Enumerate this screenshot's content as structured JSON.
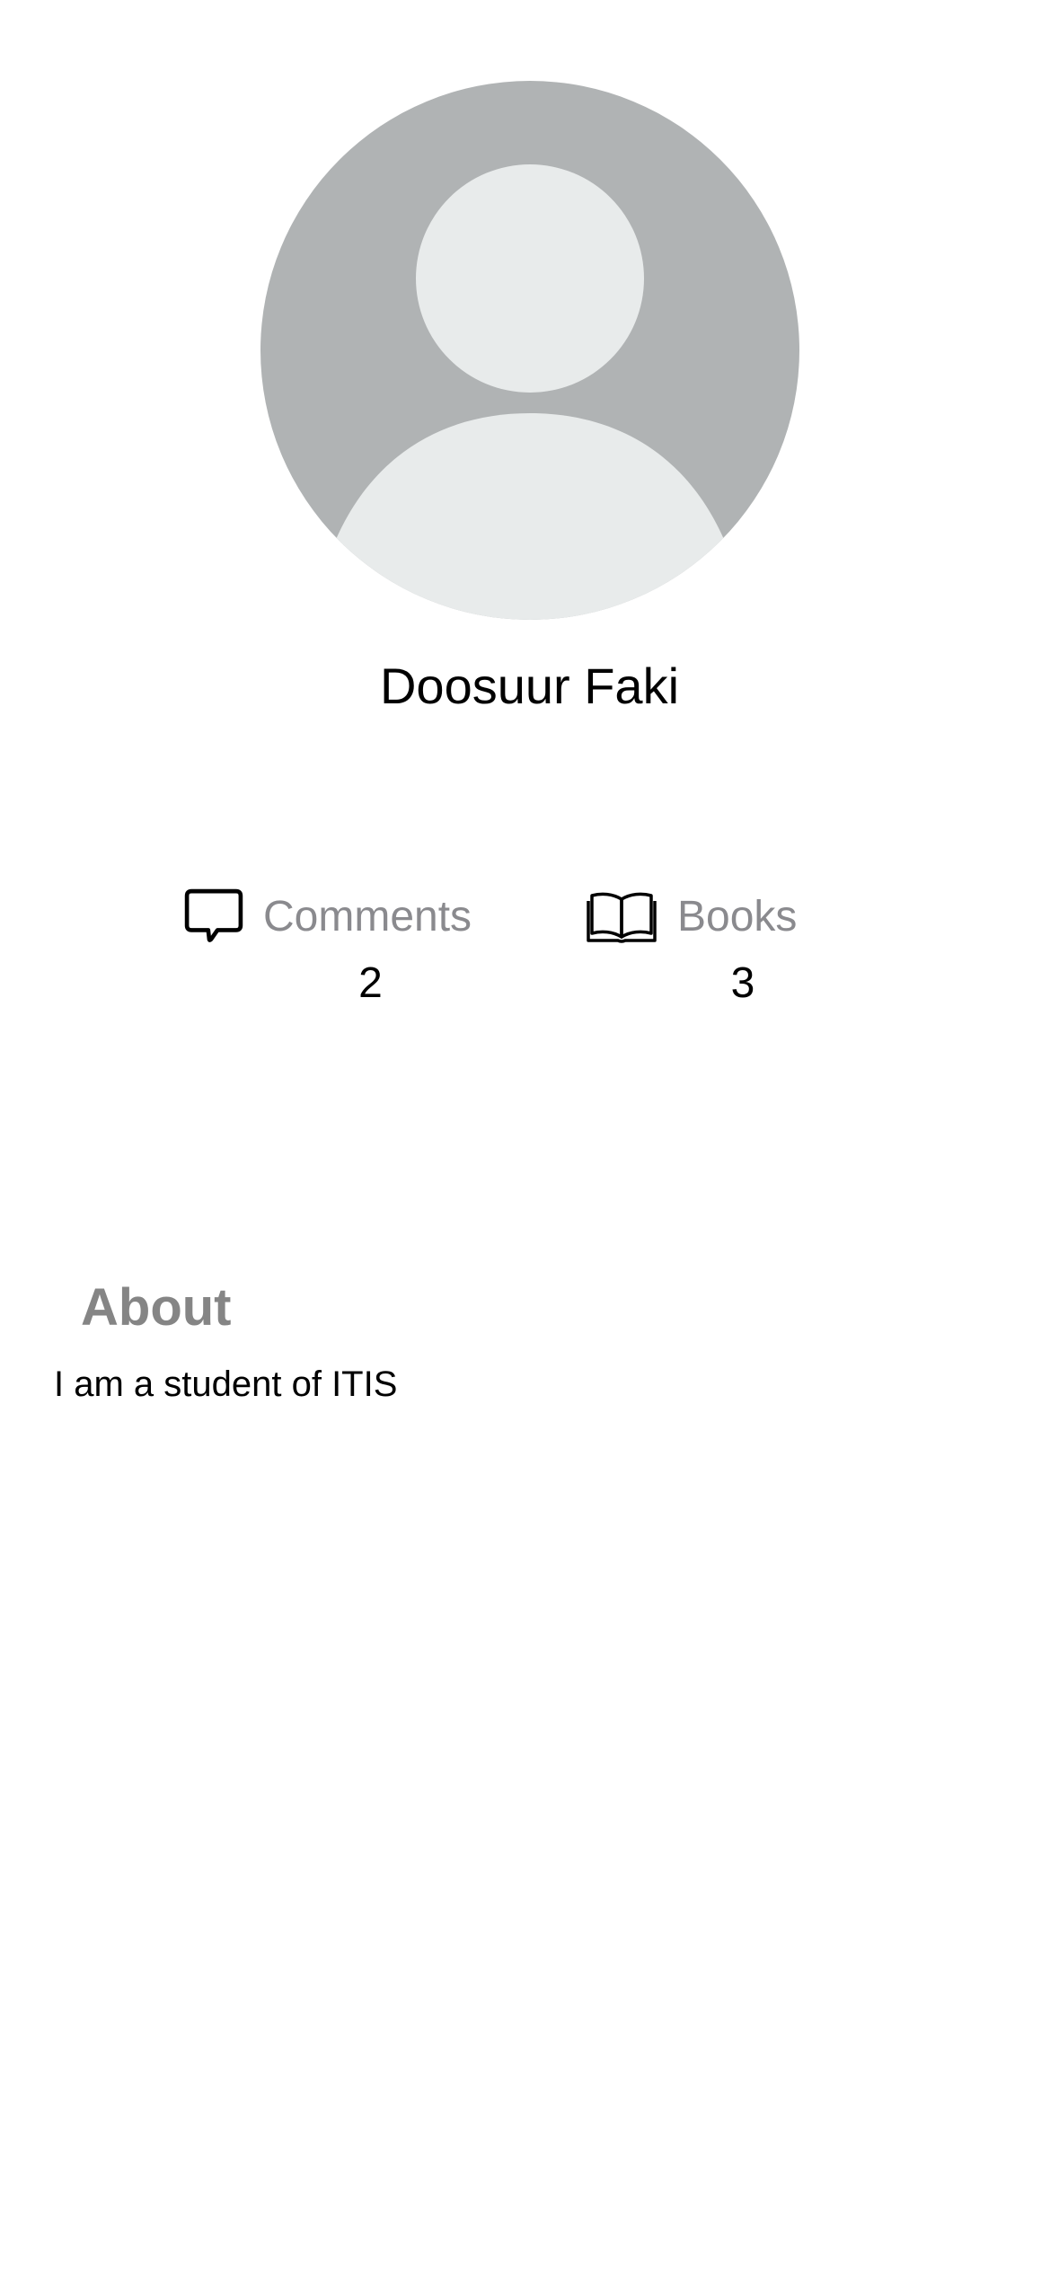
{
  "profile": {
    "name": "Doosuur Faki",
    "avatar_icon": "default-avatar-icon",
    "colors": {
      "avatar_bg": "#b0b3b4",
      "avatar_fg": "#e8ebeb"
    }
  },
  "stats": {
    "comments": {
      "icon": "speech-bubble-icon",
      "label": "Comments",
      "value": "2"
    },
    "books": {
      "icon": "open-book-icon",
      "label": "Books",
      "value": "3"
    }
  },
  "about": {
    "title": "About",
    "text": "I am a student of ITIS"
  }
}
